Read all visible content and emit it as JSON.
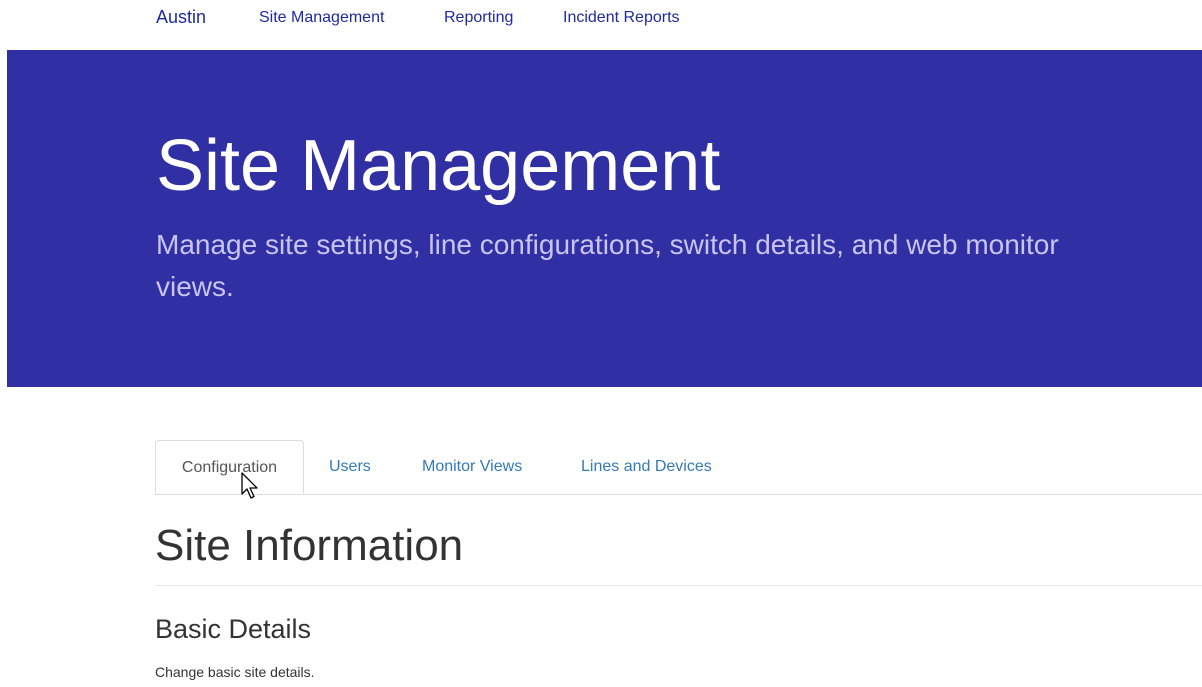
{
  "navbar": {
    "brand": "Austin",
    "links": [
      "Site Management",
      "Reporting",
      "Incident Reports"
    ]
  },
  "jumbotron": {
    "title": "Site Management",
    "subtitle": "Manage site settings, line configurations, switch details, and web monitor views."
  },
  "tabs": [
    {
      "label": "Configuration",
      "active": true
    },
    {
      "label": "Users",
      "active": false
    },
    {
      "label": "Monitor Views",
      "active": false
    },
    {
      "label": "Lines and Devices",
      "active": false
    }
  ],
  "content": {
    "section_title": "Site Information",
    "subsection_title": "Basic Details",
    "help_text": "Change basic site details."
  },
  "colors": {
    "brand_blue": "#1f2aa0",
    "jumbotron_bg": "#3030a4",
    "subtitle_text": "#c9c4ef",
    "tab_link": "#337ab7"
  },
  "icons": {
    "cursor": "mouse-pointer-icon"
  }
}
